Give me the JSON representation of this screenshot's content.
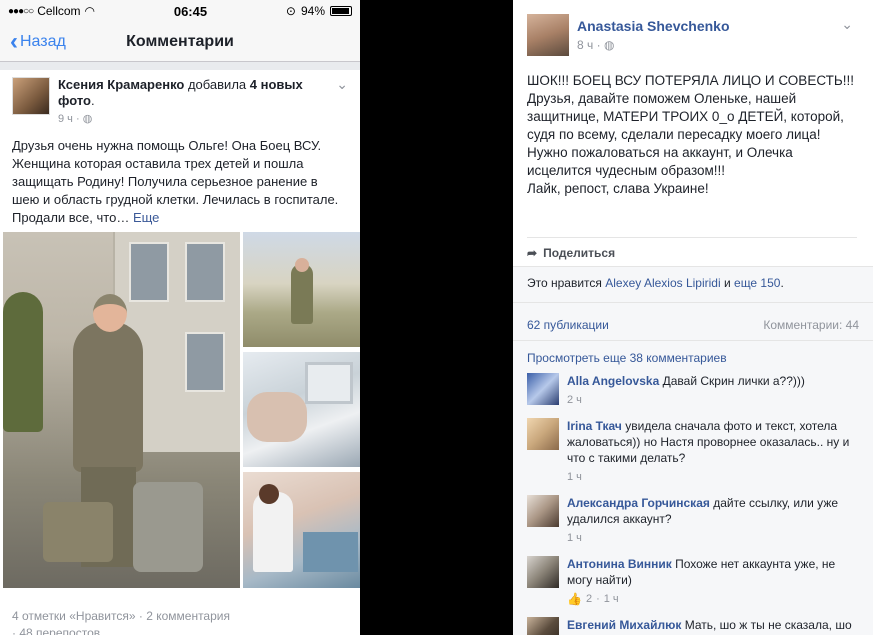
{
  "status_bar": {
    "carrier": "Cellcom",
    "time": "06:45",
    "battery": "94%"
  },
  "nav": {
    "back_label": "Назад",
    "title": "Комментарии"
  },
  "left_post": {
    "author": "Ксения Крамаренко",
    "action": " добавила ",
    "action_bold": "4 новых фото",
    "action_end": ".",
    "time": "9 ч",
    "text": "Друзья очень нужна помощь Ольге! Она Боец ВСУ. Женщина которая оставила трех детей и пошла защищать Родину! Получила серьезное ранение в шею и область грудной клетки. Лечилась в госпитале. Продали все, что…",
    "more": " Еще",
    "likes": "4 отметки «Нравится»",
    "sep": " · ",
    "comments": "2 комментария",
    "shares": "· 48 перепостов"
  },
  "right_post": {
    "author": "Anastasia Shevchenko",
    "time": "8 ч",
    "text_lines": [
      "ШОК!!! БОЕЦ ВСУ ПОТЕРЯЛА ЛИЦО И СОВЕСТЬ!!!Друзья, давайте поможем Оленьке, нашей защитнице, МАТЕРИ ТРОИХ 0_о ДЕТЕЙ, которой, судя по всему, сделали пересадку моего лица!",
      "Нужно пожаловаться на аккаунт, и Олечка исцелится чудесным образом!!!",
      "Лайк, репост, слава Украине!"
    ],
    "share_label": "Поделиться",
    "likes_prefix": "Это нравится ",
    "likes_name": "Alexey Alexios Lipiridi",
    "likes_mid": " и ",
    "likes_more": "еще 150",
    "likes_end": ".",
    "publications": "62 публикации",
    "comments_count": "Комментарии: 44",
    "view_more": "Просмотреть еще 38 комментариев",
    "comments": [
      {
        "name": "Alla Angelovska",
        "text": " Давай Скрин лички а??)))",
        "time": "2 ч",
        "color": "#4a6fb0"
      },
      {
        "name": "Irina Ткач",
        "text": " увидела сначала фото и текст, хотела жаловаться)) но Настя проворнее оказалась.. ну и что с такими делать?",
        "time": "1 ч",
        "color": "#c9a77c"
      },
      {
        "name": "Александра Горчинская",
        "text": " дайте ссылку, или уже удалился аккаунт?",
        "time": "1 ч",
        "color": "#a99584"
      },
      {
        "name": "Антонина Винник",
        "text": " Похоже нет аккаунта уже, не могу найти)",
        "like_count": "2",
        "time": "1 ч",
        "color": "#8b8478"
      },
      {
        "name": "Евгений Михайлюк",
        "text": " Мать, шо ж ты не сказала, шо у тебя трое детей?",
        "color": "#5b4c3d"
      }
    ]
  }
}
